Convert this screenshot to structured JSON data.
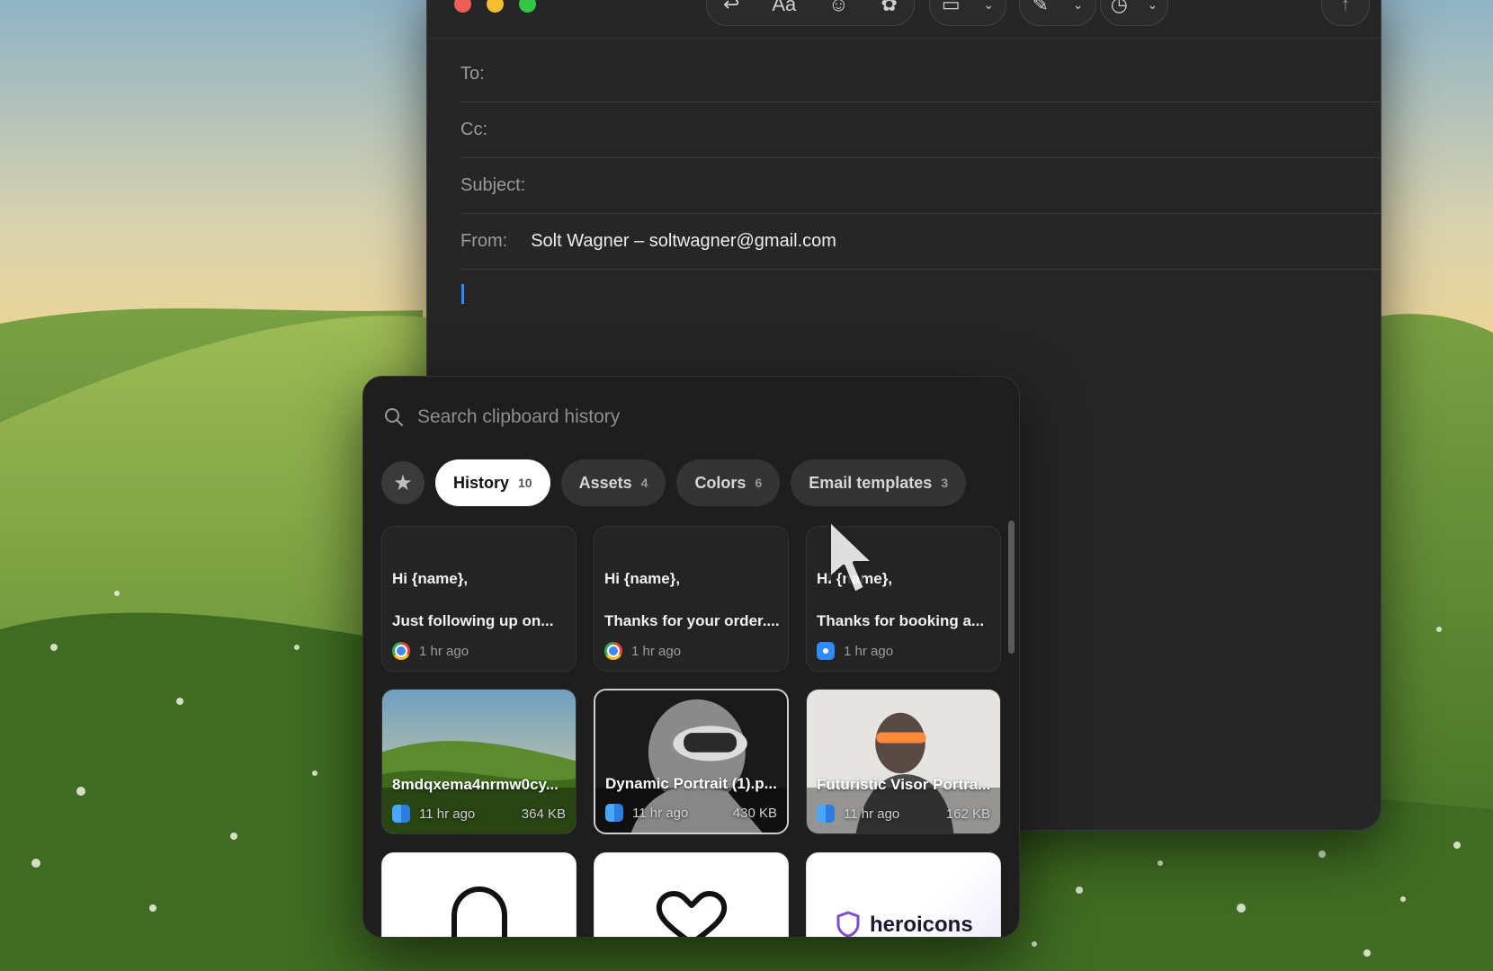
{
  "mail": {
    "toolbar": {
      "format_label": "Aa"
    },
    "fields": {
      "to_label": "To:",
      "cc_label": "Cc:",
      "subject_label": "Subject:",
      "from_label": "From:",
      "from_value": "Solt Wagner – soltwagner@gmail.com"
    }
  },
  "clipboard": {
    "search": {
      "placeholder": "Search clipboard history"
    },
    "tabs": [
      {
        "label": "History",
        "count": "10",
        "active": true
      },
      {
        "label": "Assets",
        "count": "4"
      },
      {
        "label": "Colors",
        "count": "6"
      },
      {
        "label": "Email templates",
        "count": "3"
      }
    ],
    "text_items": [
      {
        "greeting": "Hi {name},",
        "preview": "Just following up on...",
        "time": "1 hr ago",
        "app": "chrome-icon"
      },
      {
        "greeting": "Hi {name},",
        "preview": "Thanks for your order....",
        "time": "1 hr ago",
        "app": "chrome-icon"
      },
      {
        "greeting": "Hi {name},",
        "preview": "Thanks for booking a...",
        "time": "1 hr ago",
        "app": "safari-icon"
      }
    ],
    "image_items": [
      {
        "name": "8mdqxema4nrmw0cy...",
        "time": "11 hr ago",
        "size": "364 KB",
        "app": "finder-icon"
      },
      {
        "name": "Dynamic Portrait (1).p...",
        "time": "11 hr ago",
        "size": "430 KB",
        "app": "finder-icon"
      },
      {
        "name": "Futuristic Visor Portra...",
        "time": "11 hr ago",
        "size": "162 KB",
        "app": "finder-icon"
      }
    ],
    "asset_items": [
      {
        "icon": "bell-icon"
      },
      {
        "icon": "heart-icon"
      },
      {
        "icon": "heroicons-logo",
        "label": "heroicons"
      }
    ]
  }
}
